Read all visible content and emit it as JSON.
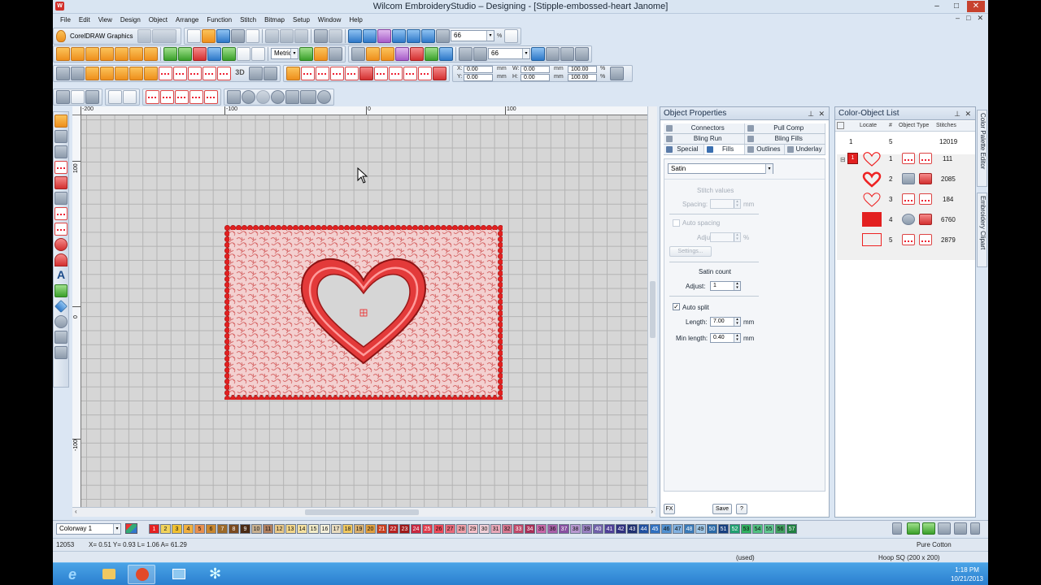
{
  "window": {
    "title": "Wilcom EmbroideryStudio – Designing - [Stipple-embossed-heart           Janome]",
    "controls": [
      "–",
      "□",
      "✕"
    ]
  },
  "menu": [
    "File",
    "Edit",
    "View",
    "Design",
    "Object",
    "Arrange",
    "Function",
    "Stitch",
    "Bitmap",
    "Setup",
    "Window",
    "Help"
  ],
  "toolbar": {
    "corel_label": "CorelDRAW Graphics",
    "zoom_value": "66",
    "units_value": "Metric",
    "zoom2_value": "66",
    "coords": {
      "x_label": "X:",
      "x_value": "0.00",
      "y_label": "Y:",
      "y_value": "0.00",
      "w_label": "W:",
      "w_value": "0.00",
      "h_label": "H:",
      "h_value": "0.00",
      "unit": "mm",
      "pw_value": "100.00",
      "ph_value": "100.00",
      "pct": "%"
    }
  },
  "ruler": {
    "h_ticks": [
      "-200",
      "-100",
      "0",
      "100"
    ],
    "v_ticks": [
      "100",
      "0",
      "-100"
    ]
  },
  "object_properties": {
    "title": "Object Properties",
    "tabs_row1": [
      "Connectors",
      "Pull Comp"
    ],
    "tabs_row2": [
      "Bling Run",
      "Bling Fills"
    ],
    "tabs_row3": [
      "Special",
      "Fills",
      "Outlines",
      "Underlay"
    ],
    "fill_type": "Satin",
    "stitch_values_label": "Stitch values",
    "spacing_label": "Spacing:",
    "mm": "mm",
    "auto_spacing_label": "Auto spacing",
    "adjust_label": "Adjust:",
    "pct": "%",
    "settings_label": "Settings...",
    "satin_count_label": "Satin count",
    "satin_adjust_label": "Adjust:",
    "satin_adjust_value": "1",
    "auto_split_label": "Auto split",
    "length_label": "Length:",
    "length_value": "7.00",
    "min_length_label": "Min length:",
    "min_length_value": "0.40",
    "fx_label": "FX",
    "save_label": "Save",
    "help_label": "?"
  },
  "color_object_list": {
    "title": "Color-Object List",
    "headers": {
      "locate": "Locate",
      "num": "#",
      "type": "Object Type",
      "stitches": "Stitches"
    },
    "summary": {
      "color_num": "1",
      "objects": "5",
      "stitches": "12019"
    },
    "color_swatch_number": "1",
    "rows": [
      {
        "num": "1",
        "stitches": "111"
      },
      {
        "num": "2",
        "stitches": "2085"
      },
      {
        "num": "3",
        "stitches": "184"
      },
      {
        "num": "4",
        "stitches": "6760"
      },
      {
        "num": "5",
        "stitches": "2879"
      }
    ],
    "side_tabs": [
      "Color Palette Editor",
      "Embroidery Clipart"
    ]
  },
  "palette": {
    "colorway": "Colorway 1",
    "swatches": [
      {
        "n": "1",
        "c": "#e52222"
      },
      {
        "n": "2",
        "c": "#f2d35a"
      },
      {
        "n": "3",
        "c": "#f0c030"
      },
      {
        "n": "4",
        "c": "#f0b040"
      },
      {
        "n": "5",
        "c": "#e89050"
      },
      {
        "n": "6",
        "c": "#c98830"
      },
      {
        "n": "7",
        "c": "#9c6a2a"
      },
      {
        "n": "8",
        "c": "#7a4a20"
      },
      {
        "n": "9",
        "c": "#4a2a14"
      },
      {
        "n": "10",
        "c": "#c8b090"
      },
      {
        "n": "11",
        "c": "#b08060"
      },
      {
        "n": "12",
        "c": "#e8c888"
      },
      {
        "n": "13",
        "c": "#f2d68a"
      },
      {
        "n": "14",
        "c": "#f4e0a0"
      },
      {
        "n": "15",
        "c": "#f2ecc8"
      },
      {
        "n": "16",
        "c": "#f4f0dc"
      },
      {
        "n": "17",
        "c": "#e8dcc0"
      },
      {
        "n": "18",
        "c": "#f0c860"
      },
      {
        "n": "19",
        "c": "#d8b070"
      },
      {
        "n": "20",
        "c": "#e0a040"
      },
      {
        "n": "21",
        "c": "#c84020"
      },
      {
        "n": "22",
        "c": "#b82020"
      },
      {
        "n": "23",
        "c": "#a01818"
      },
      {
        "n": "24",
        "c": "#c82840"
      },
      {
        "n": "25",
        "c": "#e03a4a"
      },
      {
        "n": "26",
        "c": "#f04a5a"
      },
      {
        "n": "27",
        "c": "#e86a7a"
      },
      {
        "n": "28",
        "c": "#f0a0a8"
      },
      {
        "n": "29",
        "c": "#f4c0c8"
      },
      {
        "n": "30",
        "c": "#f0d0d8"
      },
      {
        "n": "31",
        "c": "#e8a8b8"
      },
      {
        "n": "32",
        "c": "#d87890"
      },
      {
        "n": "33",
        "c": "#c04868"
      },
      {
        "n": "34",
        "c": "#a83058"
      },
      {
        "n": "35",
        "c": "#c868a8"
      },
      {
        "n": "36",
        "c": "#a860a8"
      },
      {
        "n": "37",
        "c": "#8850a0"
      },
      {
        "n": "38",
        "c": "#b898d0"
      },
      {
        "n": "39",
        "c": "#9880c0"
      },
      {
        "n": "40",
        "c": "#7060a8"
      },
      {
        "n": "41",
        "c": "#504098"
      },
      {
        "n": "42",
        "c": "#303080"
      },
      {
        "n": "43",
        "c": "#203070"
      },
      {
        "n": "44",
        "c": "#2050a0"
      },
      {
        "n": "45",
        "c": "#3070c0"
      },
      {
        "n": "46",
        "c": "#5090d0"
      },
      {
        "n": "47",
        "c": "#80b0e0"
      },
      {
        "n": "48",
        "c": "#3a7ab8"
      },
      {
        "n": "49",
        "c": "#a0c8e8"
      },
      {
        "n": "50",
        "c": "#2a6aa8"
      },
      {
        "n": "51",
        "c": "#184080"
      },
      {
        "n": "52",
        "c": "#20a070"
      },
      {
        "n": "53",
        "c": "#30b060"
      },
      {
        "n": "54",
        "c": "#50c080"
      },
      {
        "n": "55",
        "c": "#60c890"
      },
      {
        "n": "56",
        "c": "#40a060"
      },
      {
        "n": "57",
        "c": "#208040"
      }
    ]
  },
  "status": {
    "stitch_count": "12053",
    "coords": "X=   0.51 Y=   0.93 L=   1.06 A= 61.29",
    "thread": "Pure Cotton",
    "used": "(used)",
    "hoop": "Hoop SQ (200 x 200)"
  },
  "taskbar": {
    "time": "1:18 PM",
    "date": "10/21/2013"
  }
}
